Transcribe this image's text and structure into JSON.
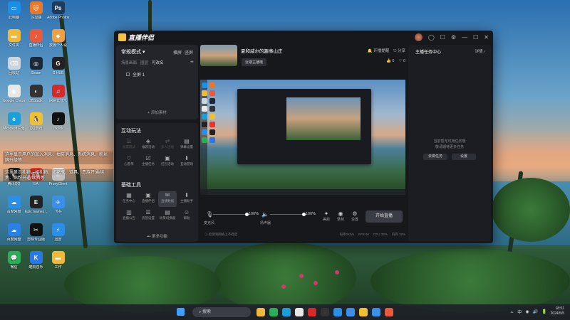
{
  "desktop_icons": [
    {
      "label": "此电脑",
      "color": "#1a8fe8",
      "glyph": "▭"
    },
    {
      "label": "1E显猫",
      "color": "#e8782a",
      "glyph": "🐱"
    },
    {
      "label": "Adobe Photoshop",
      "color": "#1e3a5c",
      "glyph": "Ps"
    },
    {
      "label": "文件夹",
      "color": "#f0b93a",
      "glyph": "▬"
    },
    {
      "label": "直播伴侣",
      "color": "#e85a3a",
      "glyph": "♪"
    },
    {
      "label": "放置个人设",
      "color": "#f0a040",
      "glyph": "◆"
    },
    {
      "label": "回收站",
      "color": "#ccd4de",
      "glyph": "⌫"
    },
    {
      "label": "Steam",
      "color": "#1b2838",
      "glyph": "◎"
    },
    {
      "label": "G HUB",
      "color": "#222222",
      "glyph": "G"
    },
    {
      "label": "Google Chrome",
      "color": "#e8e8e8",
      "glyph": "◉"
    },
    {
      "label": "OBStudio",
      "color": "#333333",
      "glyph": "◐"
    },
    {
      "label": "网易云音乐",
      "color": "#d42a2a",
      "glyph": "♫"
    },
    {
      "label": "Microsoft Edge",
      "color": "#1a9fd8",
      "glyph": "e"
    },
    {
      "label": "QQ游戏",
      "color": "#f0c030",
      "glyph": "🐧"
    },
    {
      "label": "TikTok",
      "color": "#111111",
      "glyph": "♪"
    },
    {
      "label": "",
      "color": "transparent",
      "glyph": ""
    },
    {
      "label": "",
      "color": "transparent",
      "glyph": ""
    },
    {
      "label": "",
      "color": "transparent",
      "glyph": ""
    },
    {
      "label": "腾讯QQ",
      "color": "#222222",
      "glyph": "🐧"
    },
    {
      "label": "EA",
      "color": "#e8342a",
      "glyph": "EA"
    },
    {
      "label": "ProxyClient",
      "color": "#eeeeee",
      "glyph": "▣"
    },
    {
      "label": "百度网盘",
      "color": "#2a8fe8",
      "glyph": "☁"
    },
    {
      "label": "Epic Games Launcher",
      "color": "#222222",
      "glyph": "E"
    },
    {
      "label": "飞书",
      "color": "#3a90e8",
      "glyph": "✈"
    },
    {
      "label": "百度网盘",
      "color": "#2a7fe8",
      "glyph": "☁"
    },
    {
      "label": "剪映专业版",
      "color": "#111111",
      "glyph": "✂"
    },
    {
      "label": "迅雷",
      "color": "#2a8fe8",
      "glyph": "⚡"
    },
    {
      "label": "微信",
      "color": "#2aae57",
      "glyph": "💬"
    },
    {
      "label": "酷狗音乐",
      "color": "#2a78e8",
      "glyph": "K"
    },
    {
      "label": "工作",
      "color": "#f0b93a",
      "glyph": "▬"
    }
  ],
  "notifications": [
    "这里显示用户的加入消息、抽奖消息、系统消息、粉丝牌升级等",
    "这里显示礼物，如礼物、如花瓶、道具、贵族开通/续费、贴粉开通/续费等"
  ],
  "app": {
    "title": "直播伴侣",
    "window_controls": [
      "◯",
      "☐",
      "⚙",
      "—",
      "☐",
      "✕"
    ]
  },
  "left": {
    "mode": "常规模式 ▾",
    "mode_actions": [
      "横屏",
      "竖屏"
    ],
    "tabs": [
      "场景画面",
      "图层",
      "可改名"
    ],
    "scene_item": "全屏 1",
    "add_source": "+ 添加素材",
    "interactive_title": "互动玩法",
    "interactive": [
      {
        "label": "投票玩法",
        "icon": "☰",
        "dim": true
      },
      {
        "label": "福袋活动",
        "icon": "◈",
        "dim": false
      },
      {
        "label": "多人连线",
        "icon": "⇄",
        "dim": true
      },
      {
        "label": "弹幕设置",
        "icon": "▤",
        "dim": false
      },
      {
        "label": "心愿单",
        "icon": "♡",
        "dim": false
      },
      {
        "label": "主播任务",
        "icon": "☑",
        "dim": false
      },
      {
        "label": "红包活动",
        "icon": "▣",
        "dim": false
      },
      {
        "label": "互动游戏",
        "icon": "⬇",
        "dim": false
      }
    ],
    "basic_title": "基础工具",
    "basic": [
      {
        "label": "任务中心",
        "icon": "▦",
        "selected": false
      },
      {
        "label": "直播伴侣",
        "icon": "▣",
        "selected": false
      },
      {
        "label": "直播数据",
        "icon": "✉",
        "selected": true
      },
      {
        "label": "主播助手",
        "icon": "⬇",
        "selected": false
      },
      {
        "label": "直播公告",
        "icon": "▥",
        "selected": false
      },
      {
        "label": "房管设置",
        "icon": "☰",
        "selected": false
      },
      {
        "label": "场景切换器",
        "icon": "▤",
        "selected": false
      },
      {
        "label": "帮助",
        "icon": "☺",
        "selected": false
      }
    ],
    "more": "••• 更多功能"
  },
  "center": {
    "room_name": "夏和威尔的趣事山庄",
    "room_tag": "近期主播哦",
    "top_actions": [
      "开播提醒",
      "分享"
    ],
    "likes": [
      "0",
      "0"
    ],
    "mic_label": "麦克风",
    "mic_pct": "100%",
    "sys_label": "扬声器",
    "sys_pct": "100%",
    "small_actions": [
      {
        "icon": "✦",
        "label": "美颜"
      },
      {
        "label": "录制",
        "icon": "◉"
      },
      {
        "label": "设置",
        "icon": "⚙"
      }
    ],
    "start_button": "开始直播",
    "status_warn": "ⓘ 检测到网络上不稳定",
    "status_items": [
      "码率0Kb/s",
      "FPS 60",
      "CPU 33%",
      "内存 32%"
    ]
  },
  "right": {
    "title": "主播任务中心",
    "link": "详情 ›",
    "empty1": "当前暂无可用任务哦",
    "empty2": "敬请期待更多任务",
    "btn1": "去做任务",
    "btn2": "设置"
  },
  "taskbar": {
    "search": "搜索",
    "tray": [
      "ㅅ",
      "中",
      "◉",
      "🔊",
      "🔋"
    ],
    "time": "18:51",
    "date": "2024/5/5",
    "icons": [
      {
        "name": "explorer-icon",
        "color": "#f0b93a"
      },
      {
        "name": "wechat-icon",
        "color": "#2aae57"
      },
      {
        "name": "edge-icon",
        "color": "#1a9fd8"
      },
      {
        "name": "chrome-icon",
        "color": "#e8e8e8"
      },
      {
        "name": "netease-icon",
        "color": "#d42a2a"
      },
      {
        "name": "notion-icon",
        "color": "#333333"
      },
      {
        "name": "baidu-icon",
        "color": "#2a8fe8"
      },
      {
        "name": "qq-icon",
        "color": "#3a90e8"
      },
      {
        "name": "douyin-icon",
        "color": "#f0c030"
      },
      {
        "name": "feishu-icon",
        "color": "#3a90e8"
      },
      {
        "name": "live-icon",
        "color": "#e85a3a"
      }
    ]
  }
}
